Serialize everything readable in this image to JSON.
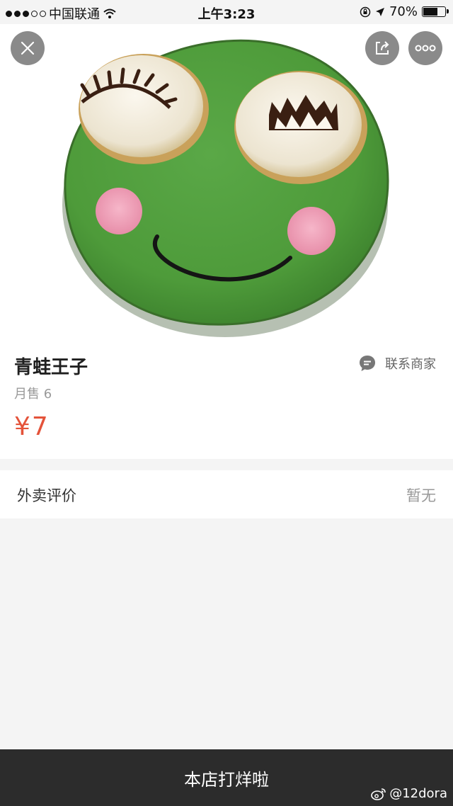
{
  "status_bar": {
    "carrier": "中国联通",
    "time": "上午3:23",
    "battery_percent": "70%",
    "battery_level": 0.7,
    "signal_bars": 3
  },
  "header": {
    "close_icon": "close-icon",
    "share_icon": "share-icon",
    "more_icon": "more-icon"
  },
  "product": {
    "name": "青蛙王子",
    "monthly_sales": "月售 6",
    "price": "¥7",
    "contact_label": "联系商家",
    "image": "frog-face-cookie"
  },
  "reviews": {
    "title": "外卖评价",
    "status": "暂无"
  },
  "footer": {
    "notice": "本店打烊啦"
  },
  "watermark": {
    "handle": "@12dora"
  },
  "colors": {
    "price": "#e4533a",
    "bottom_bar": "#2c2c2c",
    "frog_green": "#4e9b3a"
  }
}
